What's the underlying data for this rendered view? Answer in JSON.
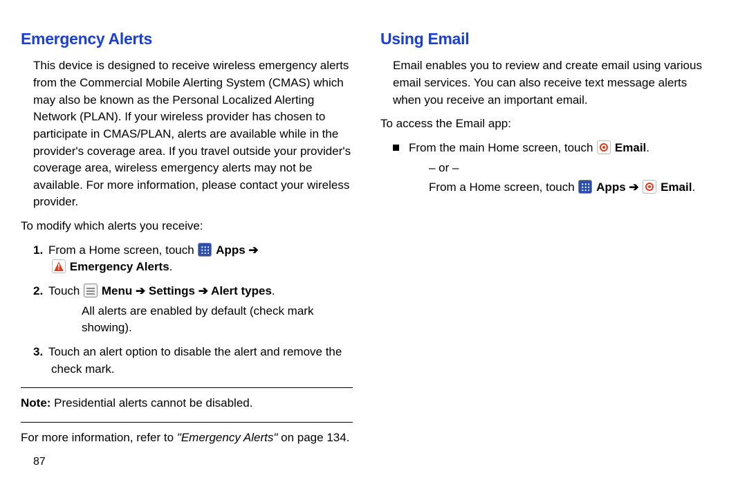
{
  "left": {
    "heading": "Emergency Alerts",
    "intro": "This device is designed to receive wireless emergency alerts from the Commercial Mobile Alerting System (CMAS) which may also be known as the Personal Localized Alerting Network (PLAN). If your wireless provider has chosen to participate in CMAS/PLAN, alerts are available while in the provider's coverage area. If you travel outside your provider's coverage area, wireless emergency alerts may not be available. For more information, please contact your wireless provider.",
    "modify_line": "To modify which alerts you receive:",
    "step1_pre": "From a Home screen, touch ",
    "step1_apps": "Apps",
    "step1_arrow": " ➔",
    "step1_alert": "Emergency Alerts",
    "step1_period": ".",
    "step2_pre": "Touch ",
    "step2_menu": "Menu",
    "step2_arrow1": " ➔ ",
    "step2_settings": "Settings",
    "step2_arrow2": " ➔ ",
    "step2_alerttypes": "Alert types",
    "step2_period": ".",
    "step2_sub": "All alerts are enabled by default (check mark showing).",
    "step3": "Touch an alert option to disable the alert and remove the check mark.",
    "note_label": "Note: ",
    "note_text": "Presidential alerts cannot be disabled.",
    "moreinfo_pre": "For more information, refer to ",
    "moreinfo_ital": "\"Emergency Alerts\"",
    "moreinfo_post": " on page 134.",
    "page_number": "87"
  },
  "right": {
    "heading": "Using Email",
    "intro": "Email enables you to review and create email using various email services. You can also receive text message alerts when you receive an important email.",
    "access_line": "To access the Email app:",
    "b1_pre": "From the main Home screen, touch ",
    "b1_email": "Email",
    "b1_period": ".",
    "or_line": "– or –",
    "b2_pre": "From a Home screen, touch ",
    "b2_apps": "Apps",
    "b2_arrow": " ➔ ",
    "b2_email": "Email",
    "b2_period": "."
  }
}
